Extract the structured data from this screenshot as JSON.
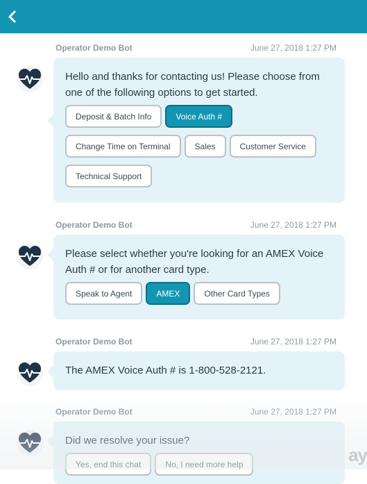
{
  "header": {
    "back_icon": "chevron-left-icon",
    "color": "#1296b3"
  },
  "messages": [
    {
      "sender": "Operator Demo Bot",
      "time": "June 27, 2018 1:27 PM",
      "text": "Hello and thanks for contacting us! Please choose from one of the following options to get started.",
      "options": [
        {
          "label": "Deposit & Batch Info",
          "selected": false
        },
        {
          "label": "Voice Auth #",
          "selected": true
        },
        {
          "label": "Change Time on Terminal",
          "selected": false
        },
        {
          "label": "Sales",
          "selected": false
        },
        {
          "label": "Customer Service",
          "selected": false
        },
        {
          "label": "Technical Support",
          "selected": false
        }
      ]
    },
    {
      "sender": "Operator Demo Bot",
      "time": "June 27, 2018 1:27 PM",
      "text": "Please select whether you're looking for an AMEX Voice Auth # or for another card type.",
      "options": [
        {
          "label": "Speak to Agent",
          "selected": false
        },
        {
          "label": "AMEX",
          "selected": true
        },
        {
          "label": "Other Card Types",
          "selected": false
        }
      ]
    },
    {
      "sender": "Operator Demo Bot",
      "time": "June 27, 2018 1:27 PM",
      "text": "The AMEX Voice Auth # is 1-800-528-2121.",
      "options": []
    },
    {
      "sender": "Operator Demo Bot",
      "time": "June 27, 2018 1:27 PM",
      "text": "Did we resolve your issue?",
      "options": [
        {
          "label": "Yes, end this chat",
          "selected": false
        },
        {
          "label": "No, I need more help",
          "selected": false
        }
      ]
    }
  ],
  "watermark": "ay",
  "colors": {
    "accent": "#1296b3",
    "bubble": "#e4f3f7",
    "avatar_heart": "#1f3347"
  }
}
